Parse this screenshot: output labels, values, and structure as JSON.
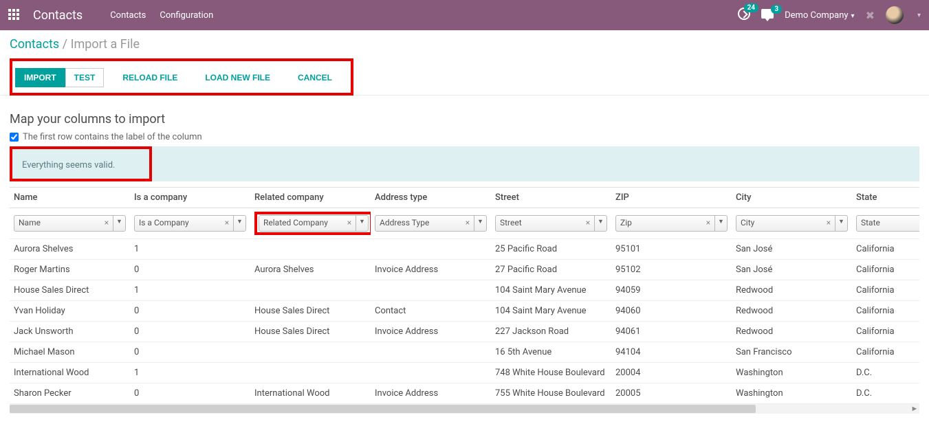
{
  "topnav": {
    "app_title": "Contacts",
    "links": [
      "Contacts",
      "Configuration"
    ],
    "activity_badge": "24",
    "msg_badge": "3",
    "company": "Demo Company"
  },
  "breadcrumb": {
    "root": "Contacts",
    "current": "Import a File"
  },
  "buttons": {
    "import": "IMPORT",
    "test": "TEST",
    "reload": "RELOAD FILE",
    "loadnew": "LOAD NEW FILE",
    "cancel": "CANCEL"
  },
  "map": {
    "title": "Map your columns to import",
    "first_row_label": "The first row contains the label of the column",
    "first_row_checked": true,
    "alert": "Everything seems valid."
  },
  "columns": {
    "headers": [
      "Name",
      "Is a company",
      "Related company",
      "Address type",
      "Street",
      "ZIP",
      "City",
      "State"
    ],
    "selections": [
      "Name",
      "Is a Company",
      "Related Company",
      "Address Type",
      "Street",
      "Zip",
      "City",
      "State"
    ]
  },
  "rows": [
    {
      "name": "Aurora Shelves",
      "is_company": "1",
      "related": "",
      "addr": "",
      "street": "25 Pacific Road",
      "zip": "95101",
      "city": "San José",
      "state": "California"
    },
    {
      "name": "Roger Martins",
      "is_company": "0",
      "related": "Aurora Shelves",
      "addr": "Invoice Address",
      "street": "27 Pacific Road",
      "zip": "95102",
      "city": "San José",
      "state": "California"
    },
    {
      "name": "House Sales Direct",
      "is_company": "1",
      "related": "",
      "addr": "",
      "street": "104 Saint Mary Avenue",
      "zip": "94059",
      "city": "Redwood",
      "state": "California"
    },
    {
      "name": "Yvan Holiday",
      "is_company": "0",
      "related": "House Sales Direct",
      "addr": "Contact",
      "street": "104 Saint Mary Avenue",
      "zip": "94060",
      "city": "Redwood",
      "state": "California"
    },
    {
      "name": "Jack Unsworth",
      "is_company": "0",
      "related": "House Sales Direct",
      "addr": "Invoice Address",
      "street": "227 Jackson Road",
      "zip": "94061",
      "city": "Redwood",
      "state": "California"
    },
    {
      "name": "Michael Mason",
      "is_company": "0",
      "related": "",
      "addr": "",
      "street": "16 5th Avenue",
      "zip": "94104",
      "city": "San Francisco",
      "state": "California"
    },
    {
      "name": "International Wood",
      "is_company": "1",
      "related": "",
      "addr": "",
      "street": "748 White House Boulevard",
      "zip": "20004",
      "city": "Washington",
      "state": "D.C."
    },
    {
      "name": "Sharon Pecker",
      "is_company": "0",
      "related": "International Wood",
      "addr": "Invoice Address",
      "street": "755 White House Boulevard",
      "zip": "20005",
      "city": "Washington",
      "state": "D.C."
    }
  ]
}
